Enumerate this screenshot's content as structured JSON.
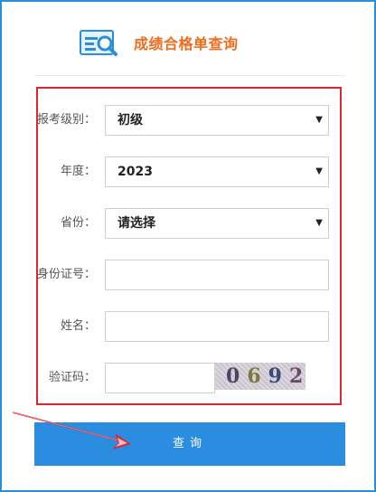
{
  "header": {
    "title": "成绩合格单查询",
    "icon": "search-document-icon"
  },
  "form": {
    "level": {
      "label": "报考级别：",
      "value": "初级"
    },
    "year": {
      "label": "年度：",
      "value": "2023"
    },
    "province": {
      "label": "省份：",
      "value": "请选择"
    },
    "id_number": {
      "label": "身份证号：",
      "value": "",
      "placeholder": ""
    },
    "name": {
      "label": "姓名：",
      "value": "",
      "placeholder": ""
    },
    "captcha": {
      "label": "验证码：",
      "value": "",
      "image_text": [
        "0",
        "6",
        "9",
        "2"
      ]
    }
  },
  "submit_label": "查询",
  "colors": {
    "frame_border": "#2a8fd8",
    "title": "#f26b1d",
    "highlight_box": "#e4232f",
    "button": "#2a8de0",
    "annotation_arrow": "#e4232f"
  }
}
